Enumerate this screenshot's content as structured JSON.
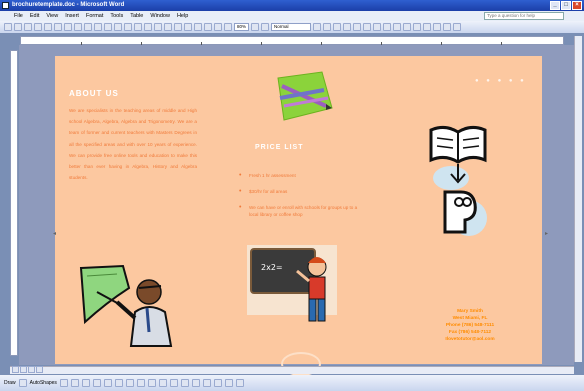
{
  "window": {
    "title": "brochuretemplate.doc - Microsoft Word"
  },
  "menu": [
    "File",
    "Edit",
    "View",
    "Insert",
    "Format",
    "Tools",
    "Table",
    "Window",
    "Help"
  ],
  "help_box": {
    "placeholder": "Type a question for help"
  },
  "toolbar": {
    "zoom": "80%",
    "style": "Normal"
  },
  "brochure": {
    "about_title": "ABOUT US",
    "about_text": "We are specialists in the teaching areas of middle and High school Algebra, Algebra, Algebra and Trigonometry. We are a team of former and current teachers with Masters Degrees in all the specified areas and with over 10 years of experience. We can provide free online tools and education to make this better than ever having in Algebra, History and Algebra students.",
    "price_title": "PRICE LIST",
    "price_items": [
      "Fresh 1 hr assessment",
      "$30/hr for all areas",
      "We can have or enroll with schools for groups up to a local library or coffee shop"
    ],
    "board_text": "2x2=",
    "contact": {
      "name": "Mary Smith",
      "address": "West Miami, FL",
      "phone": "Phone (786) 548-7111",
      "fax": "Fax (786) 548-7112",
      "email": "Ilovetotutor@aol.com"
    }
  },
  "drawbar": {
    "draw_label": "Draw",
    "autoshapes_label": "AutoShapes"
  },
  "colors": {
    "page_bg": "#fcc8a0",
    "accent_text": "#f07a3a",
    "title_text": "#ffffff",
    "contact_text": "#ff8c00"
  }
}
